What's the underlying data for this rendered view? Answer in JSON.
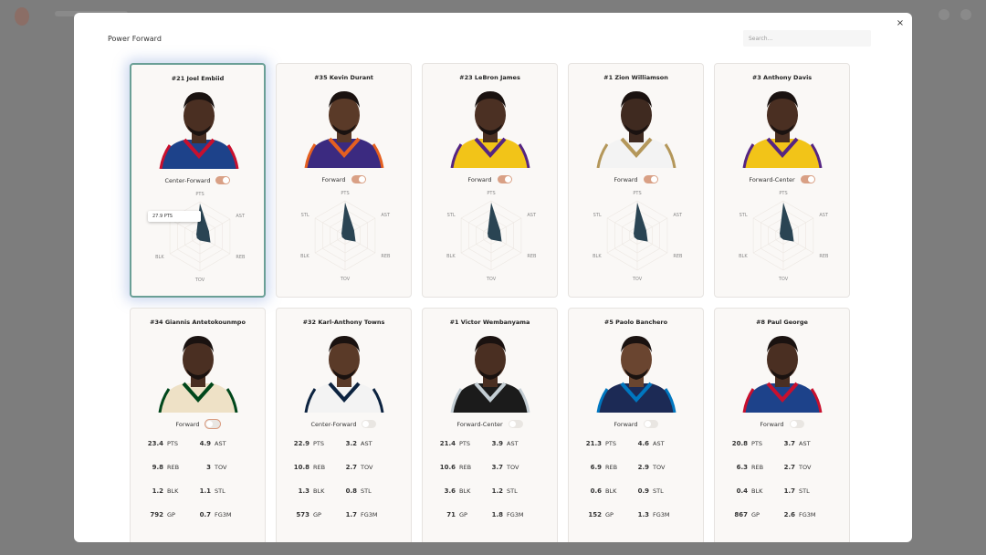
{
  "modal": {
    "title": "Power Forward",
    "close_symbol": "×",
    "search_placeholder": "Search...",
    "search_value": ""
  },
  "colors": {
    "accent": "#d9a085",
    "selected_border": "#6a9f96",
    "radar_fill": "#2a4453",
    "card_bg": "#faf8f6"
  },
  "radar_labels": [
    "PTS",
    "AST",
    "REB",
    "TOV",
    "BLK",
    "STL"
  ],
  "players": [
    {
      "name": "#21 Joel Embiid",
      "position": "Center-Forward",
      "toggle": "on",
      "view": "radar",
      "selected": true,
      "tooltip": "27.9 PTS",
      "jersey": "#1d428a",
      "trim": "#c8102e",
      "skin": "#4a2f22"
    },
    {
      "name": "#35 Kevin Durant",
      "position": "Forward",
      "toggle": "on",
      "view": "radar",
      "jersey": "#3b2a80",
      "trim": "#e56020",
      "skin": "#5a3a28"
    },
    {
      "name": "#23 LeBron James",
      "position": "Forward",
      "toggle": "on",
      "view": "radar",
      "jersey": "#f2c418",
      "trim": "#552583",
      "skin": "#4b3023"
    },
    {
      "name": "#1 Zion Williamson",
      "position": "Forward",
      "toggle": "on",
      "view": "radar",
      "jersey": "#f3f3f3",
      "trim": "#b4975a",
      "skin": "#3f2a20"
    },
    {
      "name": "#3 Anthony Davis",
      "position": "Forward-Center",
      "toggle": "on",
      "view": "radar",
      "jersey": "#f2c418",
      "trim": "#552583",
      "skin": "#4a2f22"
    },
    {
      "name": "#34 Giannis Antetokounmpo",
      "position": "Forward",
      "toggle": "off",
      "ring": true,
      "view": "stats",
      "jersey": "#eee1c6",
      "trim": "#00471b",
      "skin": "#4a2f22",
      "stats": [
        [
          "23.4",
          "PTS"
        ],
        [
          "4.9",
          "AST"
        ],
        [
          "9.8",
          "REB"
        ],
        [
          "3",
          "TOV"
        ],
        [
          "1.2",
          "BLK"
        ],
        [
          "1.1",
          "STL"
        ],
        [
          "792",
          "GP"
        ],
        [
          "0.7",
          "FG3M"
        ]
      ]
    },
    {
      "name": "#32 Karl-Anthony Towns",
      "position": "Center-Forward",
      "toggle": "off",
      "view": "stats",
      "jersey": "#f3f3f3",
      "trim": "#0c2340",
      "skin": "#5a3a28",
      "stats": [
        [
          "22.9",
          "PTS"
        ],
        [
          "3.2",
          "AST"
        ],
        [
          "10.8",
          "REB"
        ],
        [
          "2.7",
          "TOV"
        ],
        [
          "1.3",
          "BLK"
        ],
        [
          "0.8",
          "STL"
        ],
        [
          "573",
          "GP"
        ],
        [
          "1.7",
          "FG3M"
        ]
      ]
    },
    {
      "name": "#1 Victor Wembanyama",
      "position": "Forward-Center",
      "toggle": "off",
      "view": "stats",
      "jersey": "#1b1b1b",
      "trim": "#c4ced4",
      "skin": "#4a2f22",
      "stats": [
        [
          "21.4",
          "PTS"
        ],
        [
          "3.9",
          "AST"
        ],
        [
          "10.6",
          "REB"
        ],
        [
          "3.7",
          "TOV"
        ],
        [
          "3.6",
          "BLK"
        ],
        [
          "1.2",
          "STL"
        ],
        [
          "71",
          "GP"
        ],
        [
          "1.8",
          "FG3M"
        ]
      ]
    },
    {
      "name": "#5 Paolo Banchero",
      "position": "Forward",
      "toggle": "off",
      "view": "stats",
      "jersey": "#1c2a55",
      "trim": "#0077c0",
      "skin": "#6a4530",
      "stats": [
        [
          "21.3",
          "PTS"
        ],
        [
          "4.6",
          "AST"
        ],
        [
          "6.9",
          "REB"
        ],
        [
          "2.9",
          "TOV"
        ],
        [
          "0.6",
          "BLK"
        ],
        [
          "0.9",
          "STL"
        ],
        [
          "152",
          "GP"
        ],
        [
          "1.3",
          "FG3M"
        ]
      ]
    },
    {
      "name": "#8 Paul George",
      "position": "Forward",
      "toggle": "off",
      "view": "stats",
      "jersey": "#1d428a",
      "trim": "#c8102e",
      "skin": "#4a2f22",
      "stats": [
        [
          "20.8",
          "PTS"
        ],
        [
          "3.7",
          "AST"
        ],
        [
          "6.3",
          "REB"
        ],
        [
          "2.7",
          "TOV"
        ],
        [
          "0.4",
          "BLK"
        ],
        [
          "1.7",
          "STL"
        ],
        [
          "867",
          "GP"
        ],
        [
          "2.6",
          "FG3M"
        ]
      ]
    }
  ]
}
